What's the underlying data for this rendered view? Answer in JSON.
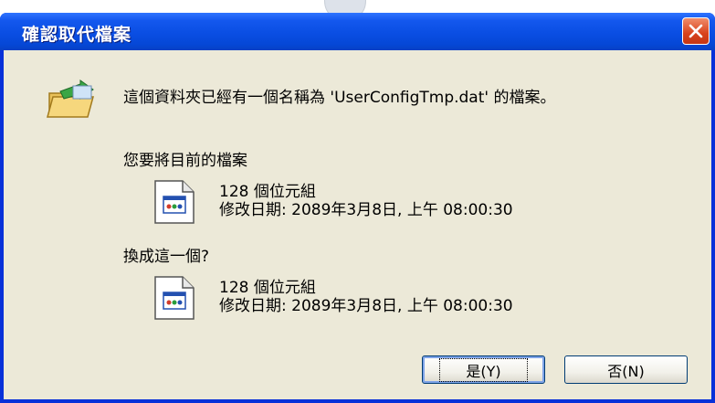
{
  "dialog": {
    "title": "確認取代檔案",
    "message": "這個資料夾已經有一個名稱為 'UserConfigTmp.dat' 的檔案。",
    "question_replace": "您要將目前的檔案",
    "question_with": "換成這一個?",
    "existing_file": {
      "size": "128 個位元組",
      "modified": "修改日期: 2089年3月8日, 上午 08:00:30"
    },
    "new_file": {
      "size": "128 個位元組",
      "modified": "修改日期: 2089年3月8日, 上午 08:00:30"
    },
    "buttons": {
      "yes_label": "是(Y)",
      "no_label": "否(N)"
    }
  },
  "icons": {
    "close": "close-icon",
    "folder": "folder-move-icon",
    "file": "file-icon"
  },
  "colors": {
    "titlebar": "#0a4ee3",
    "client_bg": "#ece9d8",
    "close_button": "#d8421c"
  }
}
